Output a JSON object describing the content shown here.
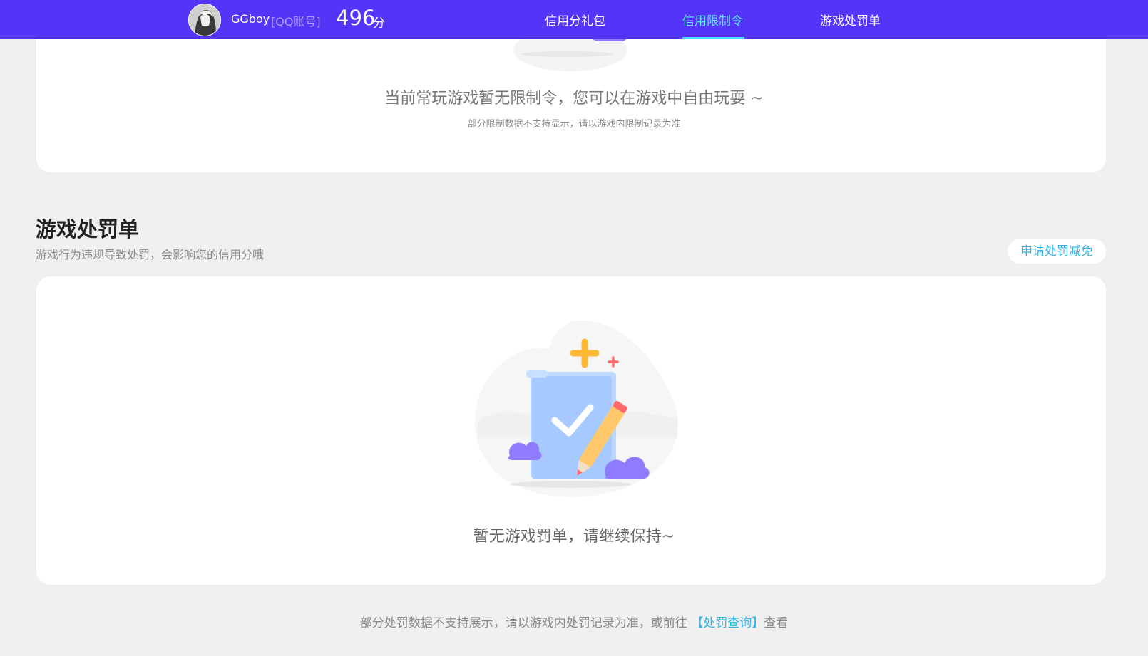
{
  "header": {
    "user_name": "GGboy",
    "account_type": "[QQ账号]",
    "score": "496",
    "score_unit": "分",
    "nav": [
      {
        "label": "信用分礼包",
        "active": false
      },
      {
        "label": "信用限制令",
        "active": true
      },
      {
        "label": "游戏处罚单",
        "active": false
      }
    ]
  },
  "limit_section": {
    "message": "当前常玩游戏暂无限制令，您可以在游戏中自由玩耍 ~",
    "note": "部分限制数据不支持显示，请以游戏内限制记录为准"
  },
  "penalty_section": {
    "title": "游戏处罚单",
    "description": "游戏行为违规导致处罚，会影响您的信用分哦",
    "appeal_button": "申请处罚减免",
    "empty_message": "暂无游戏罚单，请继续保持~"
  },
  "footer": {
    "note_prefix": "部分处罚数据不支持展示，请以游戏内处罚记录为准，或前往",
    "link_text": "【处罚查询】",
    "note_suffix": "查看"
  },
  "colors": {
    "header_bg": "#5435f8",
    "active_nav": "#62e6ff",
    "link": "#2fb5e8",
    "page_bg": "#f0f0f0"
  }
}
